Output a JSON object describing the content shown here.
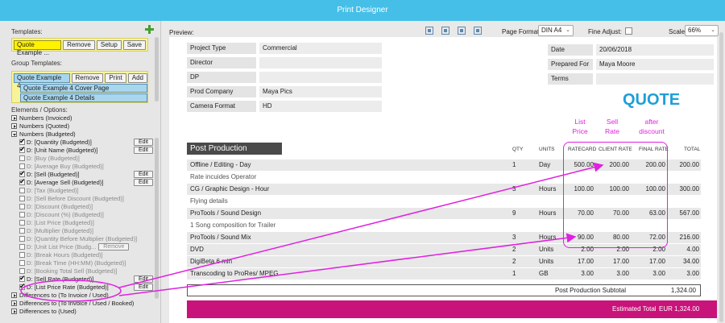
{
  "window": {
    "title": "Print Designer"
  },
  "left_panel": {
    "templates_label": "Templates:",
    "template_selected": "Quote Example ...",
    "template_buttons": [
      "Remove",
      "Setup",
      "Save"
    ],
    "group_templates_label": "Group Templates:",
    "group_selected": "Quote Example 4 ...",
    "group_buttons": [
      "Remove",
      "Print",
      "Add"
    ],
    "group_items": [
      "Quote Example 4 Cover Page",
      "Quote Example 4 Details"
    ],
    "elements_label": "Elements / Options:",
    "elements": [
      {
        "kind": "group",
        "open": false,
        "label": "Numbers (Invoiced)"
      },
      {
        "kind": "group",
        "open": false,
        "label": "Numbers (Quoted)"
      },
      {
        "kind": "group",
        "open": true,
        "label": "Numbers (Budgeted)"
      },
      {
        "kind": "item",
        "checked": true,
        "label": "D: [Quantity (Budgeted)]",
        "button": "Edit"
      },
      {
        "kind": "item",
        "checked": true,
        "label": "D: [Unit Name (Budgeted)]",
        "button": "Edit"
      },
      {
        "kind": "item",
        "checked": false,
        "label": "D: [Buy (Budgeted)]"
      },
      {
        "kind": "item",
        "checked": false,
        "label": "D: [Average Buy (Budgeted)]"
      },
      {
        "kind": "item",
        "checked": true,
        "label": "D: [Sell (Budgeted)]",
        "button": "Edit"
      },
      {
        "kind": "item",
        "checked": true,
        "label": "D: [Average Sell (Budgeted)]",
        "button": "Edit"
      },
      {
        "kind": "item",
        "checked": false,
        "label": "D: [Tax (Budgeted)]"
      },
      {
        "kind": "item",
        "checked": false,
        "label": "D: [Sell Before Discount (Budgeted)]"
      },
      {
        "kind": "item",
        "checked": false,
        "label": "D: [Discount (Budgeted)]"
      },
      {
        "kind": "item",
        "checked": false,
        "label": "D: [Discount (%) (Budgeted)]"
      },
      {
        "kind": "item",
        "checked": false,
        "label": "D: [List Price (Budgeted)]"
      },
      {
        "kind": "item",
        "checked": false,
        "label": "D: [Multiplier (Budgeted)]"
      },
      {
        "kind": "item",
        "checked": false,
        "label": "D: [Quantity Before Multiplier (Budgeted)]"
      },
      {
        "kind": "item",
        "checked": false,
        "label": "D: [Unit List Price (Budg...",
        "button": "Remove",
        "inline": true
      },
      {
        "kind": "item",
        "checked": false,
        "label": "D: [Break Hours (Budgeted)]"
      },
      {
        "kind": "item",
        "checked": false,
        "label": "D: [Break Time (HH:MM) (Budgeted)]"
      },
      {
        "kind": "item",
        "checked": false,
        "label": "D: [Booking Total Sell (Budgeted)]"
      },
      {
        "kind": "item",
        "checked": true,
        "label": "D: [Sell Rate (Budgeted)]",
        "button": "Edit"
      },
      {
        "kind": "item",
        "checked": true,
        "label": "D: [List Price Rate (Budgeted)]",
        "button": "Edit"
      },
      {
        "kind": "group",
        "open": false,
        "label": "Differences to (To Invoice / Used)"
      },
      {
        "kind": "group",
        "open": false,
        "label": "Differences to (To Invoice / Used / Booked)"
      },
      {
        "kind": "group",
        "open": false,
        "label": "Differences to (Used)"
      }
    ]
  },
  "toolbar": {
    "preview_label": "Preview:",
    "icons": [
      "align-left-icon",
      "align-center-icon",
      "align-right-icon",
      "align-bottom-icon"
    ],
    "page_format_label": "Page Format:",
    "page_format_value": "DIN A4",
    "fine_adjust_label": "Fine Adjust:",
    "scale_label": "Scale:",
    "scale_value": "66%"
  },
  "document": {
    "info_left": [
      {
        "label": "Project Type",
        "value": "Commercial"
      },
      {
        "label": "Director",
        "value": ""
      },
      {
        "label": "DP",
        "value": ""
      },
      {
        "label": "Prod Company",
        "value": "Maya Pics"
      },
      {
        "label": "Camera Format",
        "value": "HD"
      }
    ],
    "info_right": [
      {
        "label": "Date",
        "value": "20/06/2018"
      },
      {
        "label": "Prepared For",
        "value": "Maya Moore"
      },
      {
        "label": "Terms",
        "value": ""
      }
    ],
    "quote_title": "QUOTE",
    "annotations": [
      "List\nPrice",
      "Sell\nRate",
      "after\ndiscount"
    ],
    "section_title": "Post Production",
    "columns": [
      "QTY",
      "UNITS",
      "RATECARD",
      "CLIENT RATE",
      "FINAL RATE",
      "TOTAL"
    ],
    "rows": [
      {
        "desc": "Offline / Editing - Day",
        "qty": "1",
        "units": "Day",
        "ratecard": "500.00",
        "client": "200.00",
        "final": "200.00",
        "total": "200.00"
      },
      {
        "desc": "Rate incuides Operator",
        "note": true
      },
      {
        "desc": "CG / Graphic Design - Hour",
        "qty": "3",
        "units": "Hours",
        "ratecard": "100.00",
        "client": "100.00",
        "final": "100.00",
        "total": "300.00"
      },
      {
        "desc": "Flying details",
        "note": true
      },
      {
        "desc": "ProTools / Sound Design",
        "qty": "9",
        "units": "Hours",
        "ratecard": "70.00",
        "client": "70.00",
        "final": "63.00",
        "total": "567.00"
      },
      {
        "desc": "1 Song composition for Trailer",
        "note": true
      },
      {
        "desc": "ProTools / Sound Mix",
        "qty": "3",
        "units": "Hours",
        "ratecard": "90.00",
        "client": "80.00",
        "final": "72.00",
        "total": "216.00"
      },
      {
        "desc": "DVD",
        "qty": "2",
        "units": "Units",
        "ratecard": "2.00",
        "client": "2.00",
        "final": "2.00",
        "total": "4.00"
      },
      {
        "desc": "DigiBeta 6 min",
        "qty": "2",
        "units": "Units",
        "ratecard": "17.00",
        "client": "17.00",
        "final": "17.00",
        "total": "34.00"
      },
      {
        "desc": "Transcoding to ProRes/ MPEG",
        "qty": "1",
        "units": "GB",
        "ratecard": "3.00",
        "client": "3.00",
        "final": "3.00",
        "total": "3.00"
      }
    ],
    "subtotal_label": "Post Production Subtotal",
    "subtotal_value": "1,324.00",
    "estimated_total_label": "Estimated Total",
    "estimated_total_value": "EUR 1,324.00"
  },
  "colors": {
    "titlebar": "#45bfe8",
    "quote": "#1e9fd8",
    "total_bar": "#c8137a",
    "annotation": "#e020e0",
    "template_bg": "#f7f39a"
  }
}
